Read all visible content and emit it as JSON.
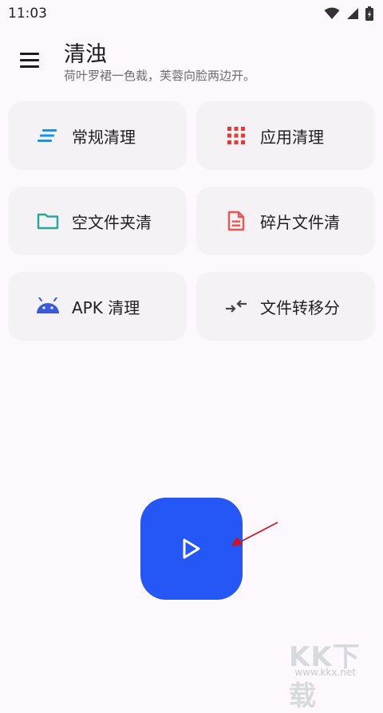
{
  "status_bar": {
    "time": "11:03"
  },
  "app_bar": {
    "title": "清浊",
    "subtitle": "荷叶罗裙一色裁，芙蓉向脸两边开。"
  },
  "cards": [
    {
      "label": "常规清理",
      "icon": "lines-icon"
    },
    {
      "label": "应用清理",
      "icon": "apps-grid-icon"
    },
    {
      "label": "空文件夹清",
      "icon": "folder-icon"
    },
    {
      "label": "碎片文件清",
      "icon": "document-icon"
    },
    {
      "label": "APK 清理",
      "icon": "android-icon"
    },
    {
      "label": "文件转移分",
      "icon": "transfer-arrows-icon"
    }
  ],
  "fab": {
    "icon": "play-icon",
    "color": "#2457f5"
  },
  "watermark": {
    "text": "KK下载",
    "url_text": "www.kkx.net"
  },
  "colors": {
    "background": "#fcf8fd",
    "card": "#f4f2f4",
    "accent_blue": "#2457f5",
    "arrow_red": "#d0121b"
  }
}
